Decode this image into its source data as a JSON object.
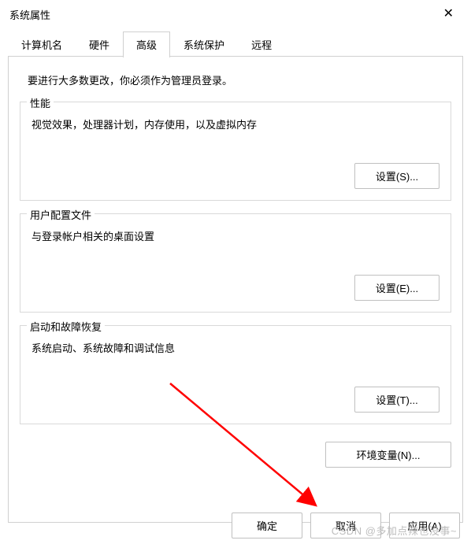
{
  "window": {
    "title": "系统属性"
  },
  "tabs": {
    "items": [
      {
        "label": "计算机名"
      },
      {
        "label": "硬件"
      },
      {
        "label": "高级"
      },
      {
        "label": "系统保护"
      },
      {
        "label": "远程"
      }
    ],
    "active_index": 2
  },
  "advanced": {
    "intro": "要进行大多数更改，你必须作为管理员登录。",
    "performance": {
      "legend": "性能",
      "desc": "视觉效果，处理器计划，内存使用，以及虚拟内存",
      "button": "设置(S)..."
    },
    "user_profiles": {
      "legend": "用户配置文件",
      "desc": "与登录帐户相关的桌面设置",
      "button": "设置(E)..."
    },
    "startup_recovery": {
      "legend": "启动和故障恢复",
      "desc": "系统启动、系统故障和调试信息",
      "button": "设置(T)..."
    },
    "env_vars_button": "环境变量(N)..."
  },
  "footer": {
    "ok": "确定",
    "cancel": "取消",
    "apply": "应用(A)"
  },
  "watermark": "CSDN @多加点辣也没事~"
}
